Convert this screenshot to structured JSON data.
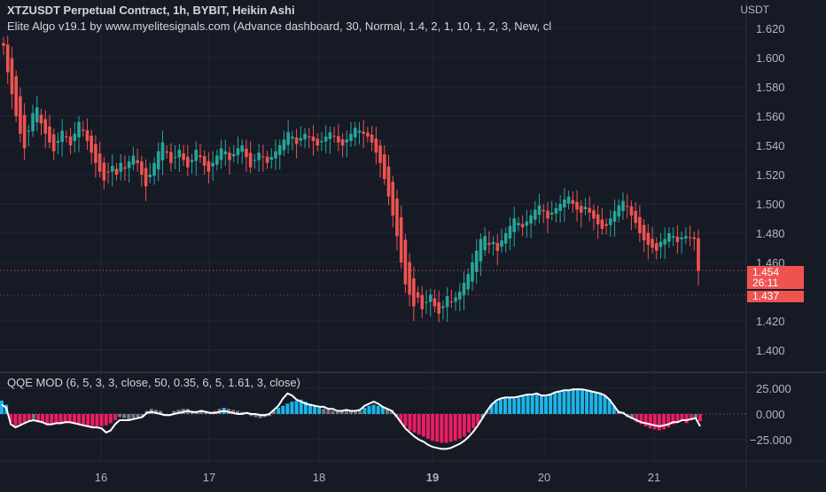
{
  "header": {
    "symbol_line": "XTZUSDT Perpetual Contract, 1h, BYBIT, Heikin Ashi",
    "indicator_line": "Elite Algo v19.1 by www.myelitesignals.com (Advance dashboard, 30, Normal, 1.4, 2, 1, 10, 1, 2, 3, New, cl",
    "currency": "USDT"
  },
  "oscillator": {
    "title": "QQE MOD (6, 5, 3, 3, close, 50, 0.35, 6, 5, 1.61, 3, close)"
  },
  "price_labels": {
    "last_price": "1.454",
    "countdown": "26:11",
    "ref_price": "1.437"
  },
  "colors": {
    "background": "#161a25",
    "grid": "#232733",
    "up": "#26a69a",
    "down": "#ef5350",
    "qqe_blue": "#1cb5e8",
    "qqe_pink": "#e91e63",
    "qqe_gray": "#787b86",
    "qqe_line": "#ffffff"
  },
  "chart_data": [
    {
      "type": "candlestick",
      "title": "XTZUSDT Perpetual Contract, 1h, BYBIT, Heikin Ashi",
      "x_ticks": [
        "16",
        "17",
        "18",
        "19",
        "20",
        "21"
      ],
      "y_ticks": [
        "1.620",
        "1.600",
        "1.580",
        "1.560",
        "1.540",
        "1.520",
        "1.500",
        "1.480",
        "1.460",
        "1.420",
        "1.400"
      ],
      "ylim": [
        1.392,
        1.627
      ],
      "grid": true,
      "close": [
        1.608,
        1.59,
        1.575,
        1.56,
        1.548,
        1.538,
        1.55,
        1.562,
        1.566,
        1.555,
        1.548,
        1.542,
        1.536,
        1.543,
        1.55,
        1.546,
        1.54,
        1.548,
        1.556,
        1.55,
        1.543,
        1.535,
        1.528,
        1.522,
        1.516,
        1.522,
        1.526,
        1.52,
        1.528,
        1.524,
        1.529,
        1.533,
        1.528,
        1.52,
        1.512,
        1.52,
        1.528,
        1.536,
        1.542,
        1.535,
        1.528,
        1.532,
        1.537,
        1.53,
        1.525,
        1.53,
        1.537,
        1.532,
        1.526,
        1.522,
        1.528,
        1.533,
        1.538,
        1.536,
        1.53,
        1.534,
        1.538,
        1.54,
        1.532,
        1.525,
        1.53,
        1.535,
        1.532,
        1.528,
        1.532,
        1.536,
        1.54,
        1.544,
        1.549,
        1.546,
        1.541,
        1.545,
        1.548,
        1.546,
        1.543,
        1.54,
        1.543,
        1.546,
        1.549,
        1.546,
        1.542,
        1.54,
        1.544,
        1.548,
        1.552,
        1.55,
        1.548,
        1.546,
        1.542,
        1.535,
        1.528,
        1.517,
        1.505,
        1.492,
        1.478,
        1.46,
        1.445,
        1.438,
        1.43,
        1.436,
        1.428,
        1.433,
        1.438,
        1.43,
        1.425,
        1.43,
        1.437,
        1.433,
        1.436,
        1.44,
        1.446,
        1.452,
        1.46,
        1.468,
        1.476,
        1.478,
        1.472,
        1.474,
        1.468,
        1.475,
        1.48,
        1.485,
        1.49,
        1.487,
        1.484,
        1.488,
        1.492,
        1.496,
        1.499,
        1.495,
        1.49,
        1.494,
        1.497,
        1.5,
        1.503,
        1.505,
        1.5,
        1.496,
        1.494,
        1.498,
        1.494,
        1.49,
        1.486,
        1.483,
        1.485,
        1.49,
        1.495,
        1.499,
        1.502,
        1.498,
        1.492,
        1.487,
        1.48,
        1.475,
        1.472,
        1.47,
        1.468,
        1.474,
        1.476,
        1.48,
        1.478,
        1.474,
        1.477,
        1.478,
        1.477,
        1.476,
        1.454
      ]
    },
    {
      "type": "bar",
      "title": "QQE MOD (6, 5, 3, 3, close, 50, 0.35, 6, 5, 1.61, 3, close)",
      "x_ticks": [
        "16",
        "17",
        "18",
        "19",
        "20",
        "21"
      ],
      "y_ticks": [
        "25.000",
        "0.000",
        "−25.000"
      ],
      "ylim": [
        -40,
        35
      ],
      "values": [
        13,
        9,
        -8,
        -12,
        -10,
        -8,
        -6,
        -5,
        -8,
        -9,
        -11,
        -10,
        -9,
        -10,
        -9,
        -8,
        -9,
        -10,
        -11,
        -12,
        -13,
        -12,
        -12,
        -11,
        -9,
        -6,
        -3,
        -4,
        -5,
        -4,
        -3,
        -2,
        3,
        5,
        4,
        3,
        -2,
        -2,
        3,
        4,
        5,
        5,
        3,
        2,
        4,
        3,
        2,
        3,
        5,
        6,
        5,
        4,
        3,
        2,
        2,
        -2,
        -3,
        -4,
        -3,
        -2,
        4,
        6,
        8,
        10,
        12,
        13,
        14,
        12,
        10,
        8,
        6,
        5,
        4,
        3,
        2,
        3,
        4,
        3,
        2,
        3,
        6,
        8,
        9,
        8,
        7,
        5,
        4,
        -3,
        -8,
        -12,
        -16,
        -18,
        -20,
        -22,
        -24,
        -26,
        -27,
        -28,
        -28,
        -27,
        -26,
        -24,
        -22,
        -18,
        -14,
        -10,
        -4,
        3,
        9,
        12,
        14,
        15,
        16,
        15,
        16,
        17,
        18,
        19,
        20,
        18,
        17,
        19,
        20,
        21,
        22,
        23,
        24,
        25,
        24,
        23,
        22,
        21,
        20,
        18,
        14,
        8,
        3,
        2,
        -3,
        -5,
        -8,
        -10,
        -12,
        -14,
        -15,
        -16,
        -15,
        -13,
        -10,
        -8,
        -7,
        -9,
        -6,
        -4,
        -7
      ],
      "line": [
        9,
        6,
        -10,
        -13,
        -11,
        -9,
        -7,
        -6,
        -7,
        -8,
        -10,
        -10,
        -9,
        -9,
        -8,
        -8,
        -9,
        -10,
        -11,
        -12,
        -13,
        -13,
        -14,
        -18,
        -16,
        -10,
        -6,
        -6,
        -6,
        -5,
        -4,
        -3,
        1,
        2,
        1,
        0,
        -1,
        -1,
        0,
        1,
        2,
        3,
        2,
        2,
        3,
        2,
        1,
        1,
        2,
        3,
        2,
        1,
        0,
        0,
        1,
        0,
        0,
        -1,
        -1,
        0,
        4,
        8,
        15,
        20,
        18,
        14,
        12,
        10,
        9,
        8,
        7,
        7,
        5,
        5,
        3,
        3,
        4,
        3,
        3,
        4,
        8,
        10,
        12,
        10,
        7,
        5,
        3,
        -2,
        -8,
        -14,
        -18,
        -22,
        -25,
        -27,
        -30,
        -32,
        -33,
        -34,
        -34,
        -33,
        -31,
        -29,
        -26,
        -22,
        -17,
        -11,
        -4,
        3,
        9,
        13,
        15,
        16,
        16,
        16,
        17,
        18,
        19,
        19,
        20,
        18,
        18,
        19,
        21,
        22,
        23,
        23,
        24,
        24,
        24,
        23,
        22,
        21,
        20,
        18,
        14,
        8,
        2,
        1,
        -2,
        -4,
        -6,
        -8,
        -9,
        -10,
        -11,
        -12,
        -11,
        -10,
        -8,
        -8,
        -6,
        -6,
        -5,
        -4,
        -12
      ]
    }
  ]
}
